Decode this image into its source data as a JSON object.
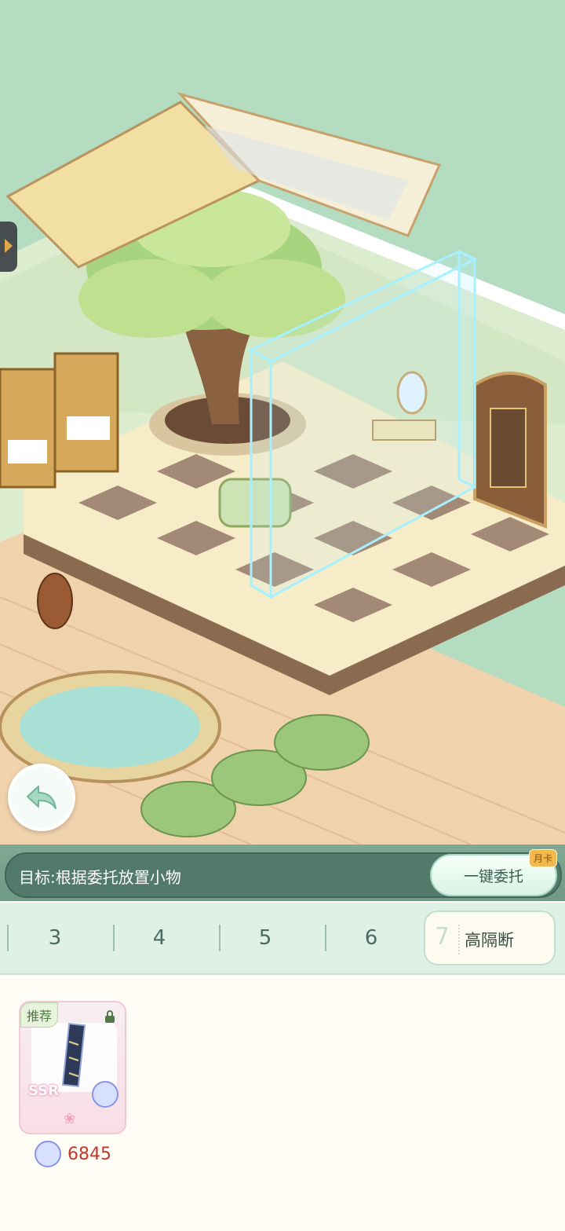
{
  "objective": {
    "text": "目标:根据委托放置小物",
    "entrust_button": "一键委托",
    "badge": "月卡"
  },
  "tabs": [
    {
      "label": "3"
    },
    {
      "label": "4"
    },
    {
      "label": "5"
    },
    {
      "label": "6"
    },
    {
      "label": "7",
      "name": "高隔断",
      "active": true
    }
  ],
  "items": [
    {
      "tag": "推荐",
      "rarity": "SSR",
      "price": "6845",
      "locked": true
    }
  ],
  "colors": {
    "scene_bg": "#b3dcc0",
    "objective_bar": "#517a6b",
    "tab_strip": "#dff0e6",
    "price_text": "#c0392b"
  },
  "icons": {
    "back": "undo-arrow-icon",
    "lock": "lock-icon",
    "currency": "gem-coin-icon",
    "side": "play-arrow-icon"
  }
}
